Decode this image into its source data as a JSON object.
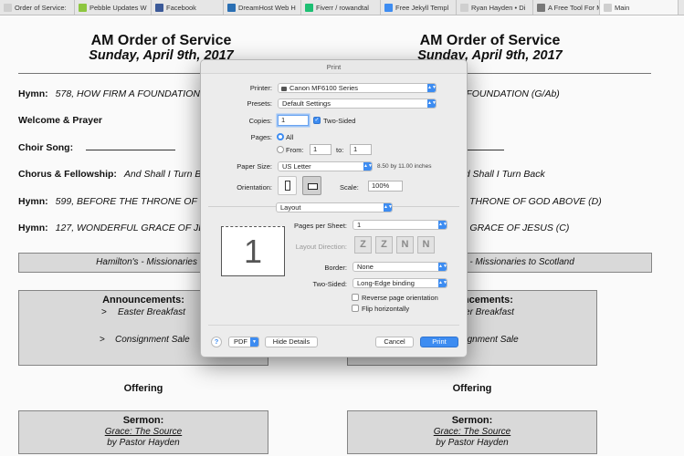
{
  "tabs": [
    {
      "label": "Order of Service:",
      "icon": "page-icon",
      "color": "#cfcfcf"
    },
    {
      "label": "Pebble Updates W",
      "icon": "pebble-icon",
      "color": "#8dc63f"
    },
    {
      "label": "Facebook",
      "icon": "facebook-icon",
      "color": "#3b5998"
    },
    {
      "label": "DreamHost Web H",
      "icon": "dreamhost-icon",
      "color": "#2a6fb3"
    },
    {
      "label": "Fiverr / rowandtal",
      "icon": "fiverr-icon",
      "color": "#1dbf73"
    },
    {
      "label": "Free Jekyll Templ",
      "icon": "jekyll-icon",
      "color": "#3d8cf1"
    },
    {
      "label": "Ryan Hayden • Di",
      "icon": "page-icon",
      "color": "#cfcfcf"
    },
    {
      "label": "A Free Tool For M",
      "icon": "globe-icon",
      "color": "#777777"
    },
    {
      "label": "Main",
      "icon": "page-icon",
      "color": "#cfcfcf"
    }
  ],
  "doc": {
    "title": "AM Order of Service",
    "date": "Sunday, April 9th, 2017",
    "hymn1_label": "Hymn:",
    "hymn1": "578, HOW FIRM A FOUNDATION (G/Ab)",
    "welcome": "Welcome & Prayer",
    "choir_label": "Choir Song:",
    "chorus_label": "Chorus & Fellowship:",
    "chorus": "And Shall I Turn Back",
    "hymn2_label": "Hymn:",
    "hymn2": "599, BEFORE THE THRONE OF GOD ABOVE (D)",
    "hymn3_label": "Hymn:",
    "hymn3": "127, WONDERFUL GRACE OF JESUS (C)",
    "missionary": "Hamilton's - Missionaries to Scotland",
    "announcements": "Announcements:",
    "ann1": "Easter Breakfast",
    "ann2": "Consignment Sale",
    "bullet": ">",
    "offering": "Offering",
    "sermon": "Sermon:",
    "sermon_title": "Grace: The Source",
    "preacher": "by Pastor Hayden"
  },
  "dialog": {
    "title": "Print",
    "printer_label": "Printer:",
    "printer": "Canon MF6100 Series",
    "presets_label": "Presets:",
    "presets": "Default Settings",
    "copies_label": "Copies:",
    "copies": "1",
    "two_sided": "Two-Sided",
    "pages_label": "Pages:",
    "all": "All",
    "from": "From:",
    "from_val": "1",
    "to": "to:",
    "to_val": "1",
    "paper_label": "Paper Size:",
    "paper": "US Letter",
    "paper_dim": "8.50 by 11.00 inches",
    "orient_label": "Orientation:",
    "scale_label": "Scale:",
    "scale": "100%",
    "section": "Layout",
    "pps_label": "Pages per Sheet:",
    "pps": "1",
    "dir_label": "Layout Direction:",
    "border_label": "Border:",
    "border": "None",
    "ts_label": "Two-Sided:",
    "ts": "Long-Edge binding",
    "reverse": "Reverse page orientation",
    "flip": "Flip horizontally",
    "preview_num": "1",
    "help": "?",
    "pdf": "PDF",
    "hide": "Hide Details",
    "cancel": "Cancel",
    "print": "Print"
  }
}
